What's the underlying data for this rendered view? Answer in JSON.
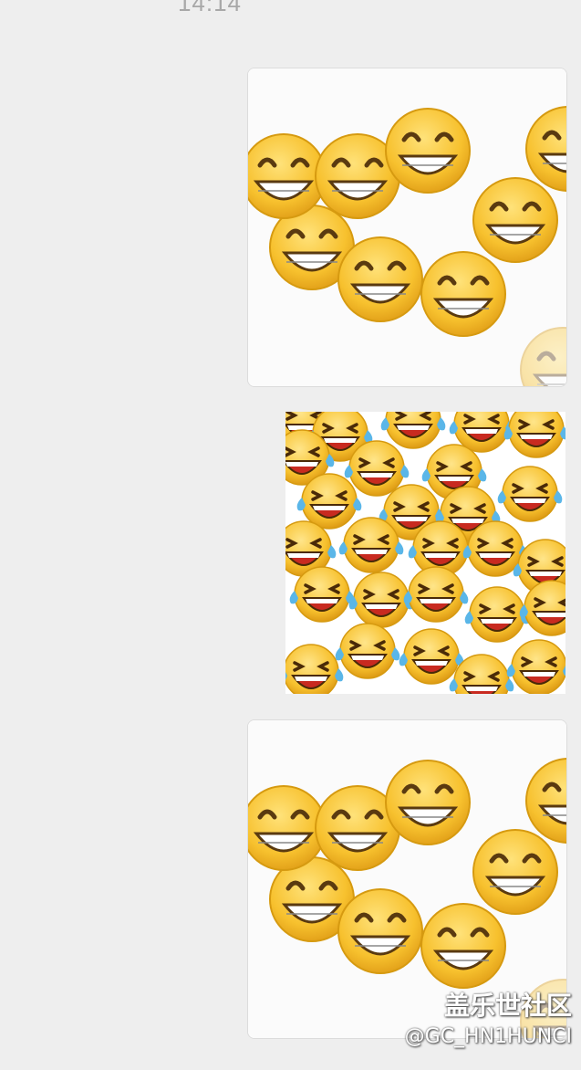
{
  "chat": {
    "timestamp": "14:14",
    "messages": [
      {
        "type": "sticker",
        "icon": "grinning-faces-sticker"
      },
      {
        "type": "sticker",
        "icon": "tears-of-joy-faces-sticker"
      },
      {
        "type": "sticker",
        "icon": "grinning-faces-sticker"
      }
    ]
  },
  "watermark": {
    "site": "盖乐世社区",
    "user": "@GC_HN1HUNCI"
  },
  "colors": {
    "background": "#eeeeee",
    "emoji_yellow": "#f7c12e",
    "emoji_outline": "#d69a10",
    "mouth_red": "#c82a20",
    "tear_blue": "#5ab6e8"
  }
}
